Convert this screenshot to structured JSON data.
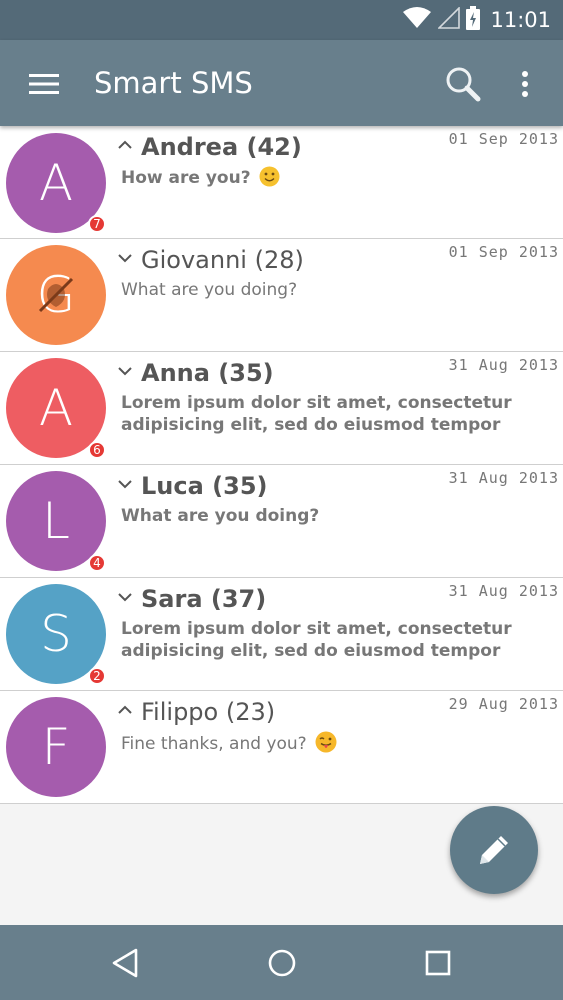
{
  "status_bar": {
    "time": "11:01",
    "icons": [
      "wifi-icon",
      "signal-icon",
      "battery-charging-icon"
    ]
  },
  "app_bar": {
    "title": "Smart SMS",
    "icons": [
      "menu-icon",
      "search-icon",
      "more-vert-icon"
    ]
  },
  "conversations": [
    {
      "initial": "A",
      "name": "Andrea (42)",
      "date": "01 Sep 2013",
      "preview": "How are you?",
      "emoji": "smile",
      "badge": "7",
      "color": "#a55cad",
      "bold": true,
      "chevron": "up"
    },
    {
      "initial": "G",
      "name": "Giovanni (28)",
      "date": "01 Sep 2013",
      "preview": "What are you doing?",
      "emoji": "",
      "badge": "",
      "color": "#f58a4f",
      "bold": false,
      "chevron": "down"
    },
    {
      "initial": "A",
      "name": "Anna (35)",
      "date": "31 Aug 2013",
      "preview": "Lorem ipsum dolor sit amet, consectetur adipisicing elit, sed do eiusmod tempor incididunt ut labore et",
      "emoji": "",
      "badge": "6",
      "color": "#ee5d62",
      "bold": true,
      "chevron": "down"
    },
    {
      "initial": "L",
      "name": "Luca (35)",
      "date": "31 Aug 2013",
      "preview": "What are you doing?",
      "emoji": "",
      "badge": "4",
      "color": "#a55cad",
      "bold": true,
      "chevron": "down"
    },
    {
      "initial": "S",
      "name": "Sara (37)",
      "date": "31 Aug 2013",
      "preview": "Lorem ipsum dolor sit amet, consectetur adipisicing elit, sed do eiusmod tempor incididunt ut labore et",
      "emoji": "",
      "badge": "2",
      "color": "#55a2c6",
      "bold": true,
      "chevron": "down"
    },
    {
      "initial": "F",
      "name": "Filippo (23)",
      "date": "29 Aug 2013",
      "preview": "Fine thanks, and you?",
      "emoji": "tongue",
      "badge": "",
      "color": "#a55cad",
      "bold": false,
      "chevron": "up"
    }
  ],
  "fab": {
    "icon": "pencil-icon",
    "color": "#5f7b89"
  },
  "nav_bar": {
    "icons": [
      "back-icon",
      "home-icon",
      "recents-icon"
    ]
  },
  "colors": {
    "status_bar": "#546a78",
    "app_bar": "#687f8c",
    "badge": "#e53935"
  }
}
